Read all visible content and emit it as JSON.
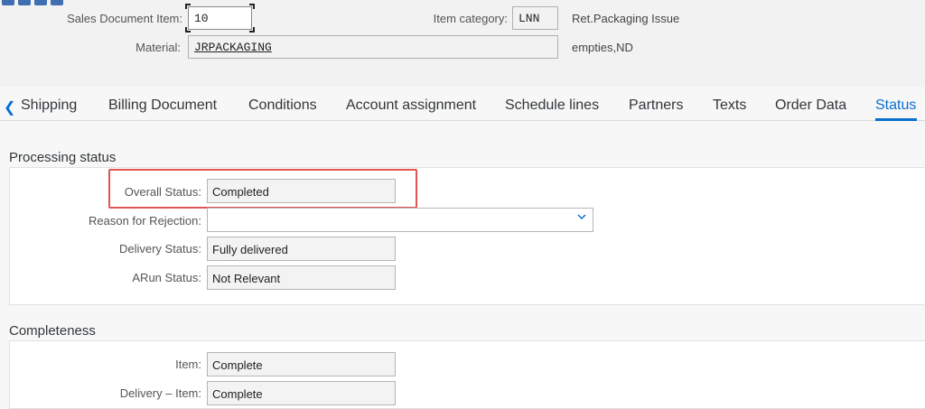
{
  "header": {
    "sales_doc_item_label": "Sales Document Item:",
    "sales_doc_item_value": "10",
    "item_category_label": "Item category:",
    "item_category_value": "LNN",
    "item_category_desc": "Ret.Packaging Issue",
    "material_label": "Material:",
    "material_value": "JRPACKAGING",
    "material_desc": "empties,ND"
  },
  "tabs": [
    {
      "label": "Shipping"
    },
    {
      "label": "Billing Document"
    },
    {
      "label": "Conditions"
    },
    {
      "label": "Account assignment"
    },
    {
      "label": "Schedule lines"
    },
    {
      "label": "Partners"
    },
    {
      "label": "Texts"
    },
    {
      "label": "Order Data"
    },
    {
      "label": "Status",
      "selected": true
    }
  ],
  "processing_status": {
    "title": "Processing status",
    "overall_status_label": "Overall Status:",
    "overall_status_value": "Completed",
    "reason_rejection_label": "Reason for Rejection:",
    "reason_rejection_value": "",
    "delivery_status_label": "Delivery Status:",
    "delivery_status_value": "Fully delivered",
    "arun_status_label": "ARun Status:",
    "arun_status_value": "Not Relevant"
  },
  "completeness": {
    "title": "Completeness",
    "item_label": "Item:",
    "item_value": "Complete",
    "delivery_item_label": "Delivery – Item:",
    "delivery_item_value": "Complete"
  },
  "colors": {
    "accent": "#0a6ed1",
    "highlight": "#e05454"
  }
}
